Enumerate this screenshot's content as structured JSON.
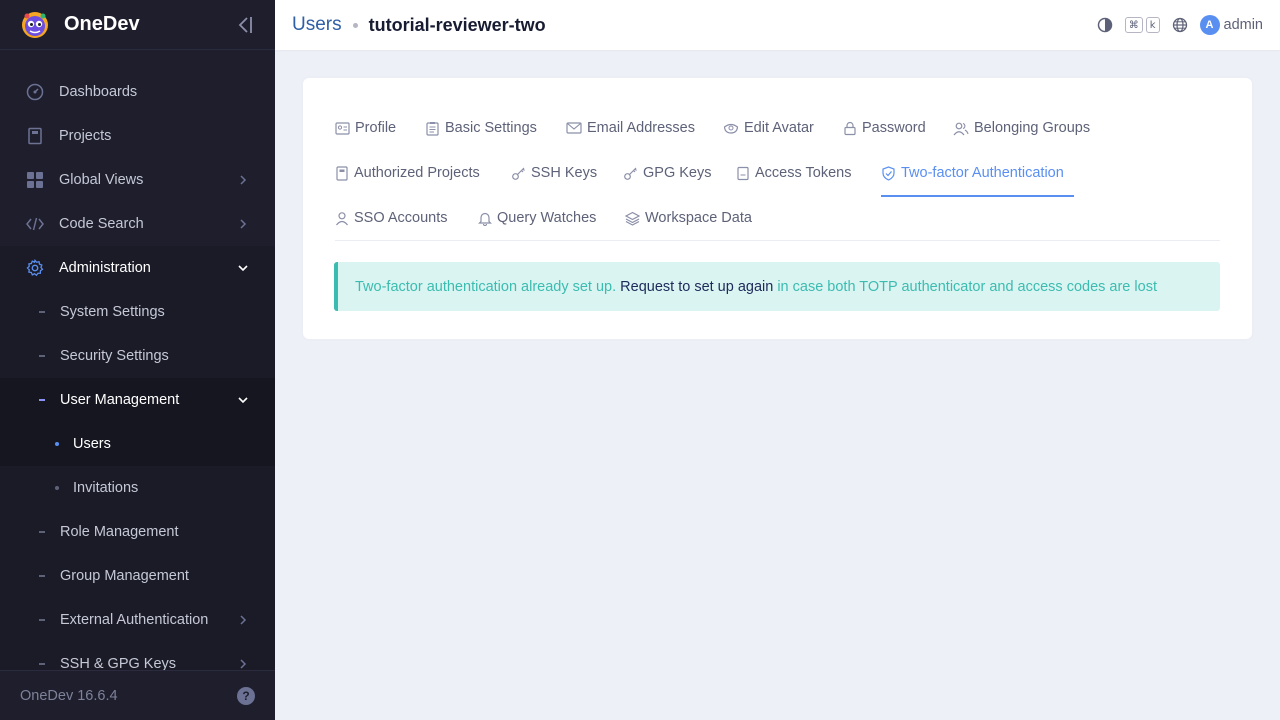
{
  "brand": {
    "name": "OneDev"
  },
  "sidebar": {
    "items": [
      {
        "label": "Dashboards"
      },
      {
        "label": "Projects"
      },
      {
        "label": "Global Views"
      },
      {
        "label": "Code Search"
      },
      {
        "label": "Administration"
      }
    ],
    "admin_items": [
      {
        "label": "System Settings"
      },
      {
        "label": "Security Settings"
      },
      {
        "label": "User Management"
      },
      {
        "label": "Role Management"
      },
      {
        "label": "Group Management"
      },
      {
        "label": "External Authentication"
      },
      {
        "label": "SSH & GPG Keys"
      }
    ],
    "user_mgmt_items": [
      {
        "label": "Users"
      },
      {
        "label": "Invitations"
      }
    ],
    "footer_version": "OneDev 16.6.4",
    "help_glyph": "?"
  },
  "topbar": {
    "crumb_root": "Users",
    "crumb_current": "tutorial-reviewer-two",
    "kbd_cmd": "⌘",
    "kbd_k": "k",
    "avatar_letter": "A",
    "user_name": "admin"
  },
  "tabs": [
    {
      "label": "Profile"
    },
    {
      "label": "Basic Settings"
    },
    {
      "label": "Email Addresses"
    },
    {
      "label": "Edit Avatar"
    },
    {
      "label": "Password"
    },
    {
      "label": "Belonging Groups"
    },
    {
      "label": "Authorized Projects"
    },
    {
      "label": "SSH Keys"
    },
    {
      "label": "GPG Keys"
    },
    {
      "label": "Access Tokens"
    },
    {
      "label": "Two-factor Authentication"
    },
    {
      "label": "SSO Accounts"
    },
    {
      "label": "Query Watches"
    },
    {
      "label": "Workspace Data"
    }
  ],
  "alert": {
    "text_before": "Two-factor authentication already set up.",
    "link": "Request to set up again",
    "text_after": "in case both TOTP authenticator and access codes are lost"
  },
  "colors": {
    "accent": "#5a8ff2",
    "sidebar_bg": "#1e1e2d",
    "alert_bg": "#daf4f2",
    "alert_text": "#3cbcb0"
  }
}
